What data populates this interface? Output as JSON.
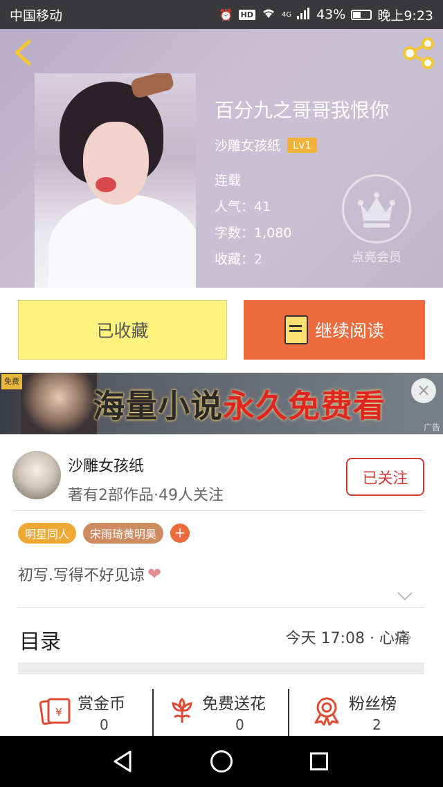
{
  "status_bar": {
    "carrier": "中国移动",
    "network": "4G",
    "battery": "43%",
    "time": "晚上9:23"
  },
  "book": {
    "title": "百分九之哥哥我恨你",
    "author": "沙雕女孩纸",
    "level": "Lv1",
    "status": "连载",
    "popularity": "人气：41",
    "word_count": "字数：1,080",
    "favorites": "收藏：2",
    "vip_label": "点亮会员"
  },
  "actions": {
    "collected_label": "已收藏",
    "continue_label": "继续阅读"
  },
  "ad": {
    "free_tag": "免费",
    "text_part1": "海量小说",
    "text_part2": "永久免费看",
    "close": "×",
    "label": "广告"
  },
  "author_card": {
    "name": "沙雕女孩纸",
    "stats": "著有2部作品·49人关注",
    "follow_label": "已关注"
  },
  "tags": [
    "明星同人",
    "宋雨琦黄明昊"
  ],
  "tag_add": "+",
  "intro": "初写.写得不好见谅",
  "toc": {
    "title": "目录",
    "latest": "今天 17:08 · 心痛"
  },
  "stats_row": [
    {
      "label": "赏金币",
      "value": "0",
      "icon": "red-envelope-icon"
    },
    {
      "label": "免费送花",
      "value": "0",
      "icon": "flower-icon"
    },
    {
      "label": "粉丝榜",
      "value": "2",
      "icon": "medal-icon"
    }
  ],
  "colors": {
    "accent_orange": "#ec6a3b",
    "collect_yellow": "#fdf27e",
    "follow_red": "#cf3b33",
    "tag_orange": "#f0a834",
    "tag_brown": "#cf8b60"
  }
}
